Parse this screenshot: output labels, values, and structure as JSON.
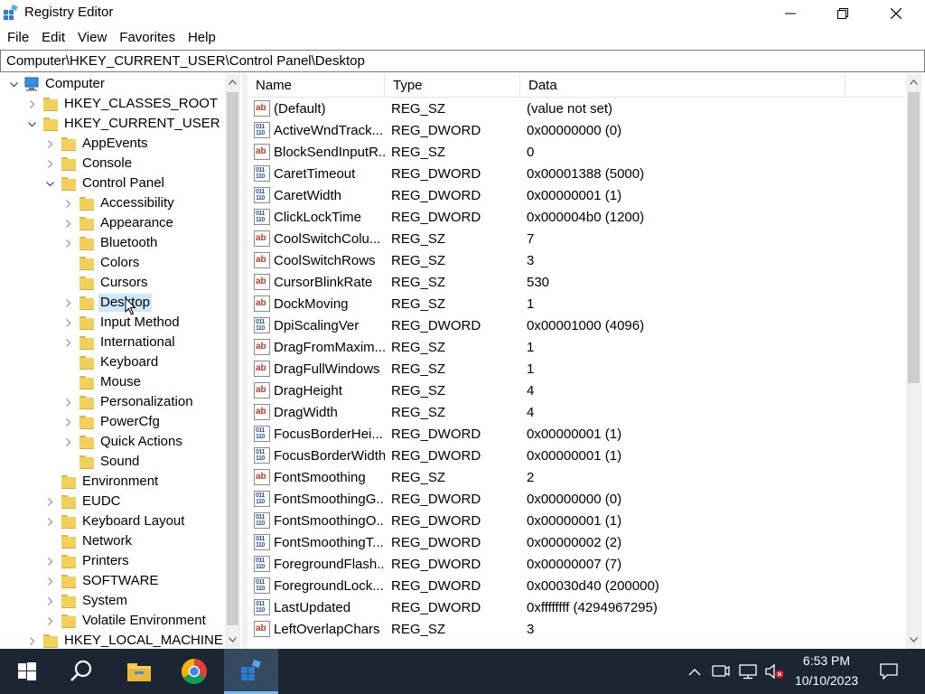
{
  "window": {
    "title": "Registry Editor",
    "app_icon": "registry-editor-icon",
    "controls": [
      "minimize-icon",
      "restore-icon",
      "close-icon"
    ]
  },
  "menu": [
    "File",
    "Edit",
    "View",
    "Favorites",
    "Help"
  ],
  "address": "Computer\\HKEY_CURRENT_USER\\Control Panel\\Desktop",
  "tree": [
    {
      "label": "Computer",
      "level": 0,
      "expanded": true,
      "icon": "computer-icon"
    },
    {
      "label": "HKEY_CLASSES_ROOT",
      "level": 1,
      "expanded": false
    },
    {
      "label": "HKEY_CURRENT_USER",
      "level": 1,
      "expanded": true
    },
    {
      "label": "AppEvents",
      "level": 2,
      "expanded": false
    },
    {
      "label": "Console",
      "level": 2,
      "expanded": false
    },
    {
      "label": "Control Panel",
      "level": 2,
      "expanded": true
    },
    {
      "label": "Accessibility",
      "level": 3,
      "expanded": false
    },
    {
      "label": "Appearance",
      "level": 3,
      "expanded": false
    },
    {
      "label": "Bluetooth",
      "level": 3,
      "expanded": false
    },
    {
      "label": "Colors",
      "level": 3,
      "leaf": true
    },
    {
      "label": "Cursors",
      "level": 3,
      "leaf": true
    },
    {
      "label": "Desktop",
      "level": 3,
      "expanded": false,
      "selected": true
    },
    {
      "label": "Input Method",
      "level": 3,
      "expanded": false
    },
    {
      "label": "International",
      "level": 3,
      "expanded": false
    },
    {
      "label": "Keyboard",
      "level": 3,
      "leaf": true
    },
    {
      "label": "Mouse",
      "level": 3,
      "leaf": true
    },
    {
      "label": "Personalization",
      "level": 3,
      "expanded": false
    },
    {
      "label": "PowerCfg",
      "level": 3,
      "expanded": false
    },
    {
      "label": "Quick Actions",
      "level": 3,
      "expanded": false
    },
    {
      "label": "Sound",
      "level": 3,
      "leaf": true
    },
    {
      "label": "Environment",
      "level": 2,
      "leaf": true
    },
    {
      "label": "EUDC",
      "level": 2,
      "expanded": false
    },
    {
      "label": "Keyboard Layout",
      "level": 2,
      "expanded": false
    },
    {
      "label": "Network",
      "level": 2,
      "leaf": true
    },
    {
      "label": "Printers",
      "level": 2,
      "expanded": false
    },
    {
      "label": "SOFTWARE",
      "level": 2,
      "expanded": false
    },
    {
      "label": "System",
      "level": 2,
      "expanded": false
    },
    {
      "label": "Volatile Environment",
      "level": 2,
      "expanded": false
    },
    {
      "label": "HKEY_LOCAL_MACHINE",
      "level": 1,
      "expanded": false
    }
  ],
  "columns": [
    "Name",
    "Type",
    "Data"
  ],
  "values": [
    {
      "name": "(Default)",
      "type": "REG_SZ",
      "data": "(value not set)",
      "icon": "string-value-icon"
    },
    {
      "name": "ActiveWndTrack...",
      "type": "REG_DWORD",
      "data": "0x00000000 (0)",
      "icon": "binary-value-icon"
    },
    {
      "name": "BlockSendInputR...",
      "type": "REG_SZ",
      "data": "0",
      "icon": "string-value-icon"
    },
    {
      "name": "CaretTimeout",
      "type": "REG_DWORD",
      "data": "0x00001388 (5000)",
      "icon": "binary-value-icon"
    },
    {
      "name": "CaretWidth",
      "type": "REG_DWORD",
      "data": "0x00000001 (1)",
      "icon": "binary-value-icon"
    },
    {
      "name": "ClickLockTime",
      "type": "REG_DWORD",
      "data": "0x000004b0 (1200)",
      "icon": "binary-value-icon"
    },
    {
      "name": "CoolSwitchColu...",
      "type": "REG_SZ",
      "data": "7",
      "icon": "string-value-icon"
    },
    {
      "name": "CoolSwitchRows",
      "type": "REG_SZ",
      "data": "3",
      "icon": "string-value-icon"
    },
    {
      "name": "CursorBlinkRate",
      "type": "REG_SZ",
      "data": "530",
      "icon": "string-value-icon"
    },
    {
      "name": "DockMoving",
      "type": "REG_SZ",
      "data": "1",
      "icon": "string-value-icon"
    },
    {
      "name": "DpiScalingVer",
      "type": "REG_DWORD",
      "data": "0x00001000 (4096)",
      "icon": "binary-value-icon"
    },
    {
      "name": "DragFromMaxim...",
      "type": "REG_SZ",
      "data": "1",
      "icon": "string-value-icon"
    },
    {
      "name": "DragFullWindows",
      "type": "REG_SZ",
      "data": "1",
      "icon": "string-value-icon"
    },
    {
      "name": "DragHeight",
      "type": "REG_SZ",
      "data": "4",
      "icon": "string-value-icon"
    },
    {
      "name": "DragWidth",
      "type": "REG_SZ",
      "data": "4",
      "icon": "string-value-icon"
    },
    {
      "name": "FocusBorderHei...",
      "type": "REG_DWORD",
      "data": "0x00000001 (1)",
      "icon": "binary-value-icon"
    },
    {
      "name": "FocusBorderWidth",
      "type": "REG_DWORD",
      "data": "0x00000001 (1)",
      "icon": "binary-value-icon"
    },
    {
      "name": "FontSmoothing",
      "type": "REG_SZ",
      "data": "2",
      "icon": "string-value-icon"
    },
    {
      "name": "FontSmoothingG...",
      "type": "REG_DWORD",
      "data": "0x00000000 (0)",
      "icon": "binary-value-icon"
    },
    {
      "name": "FontSmoothingO...",
      "type": "REG_DWORD",
      "data": "0x00000001 (1)",
      "icon": "binary-value-icon"
    },
    {
      "name": "FontSmoothingT...",
      "type": "REG_DWORD",
      "data": "0x00000002 (2)",
      "icon": "binary-value-icon"
    },
    {
      "name": "ForegroundFlash...",
      "type": "REG_DWORD",
      "data": "0x00000007 (7)",
      "icon": "binary-value-icon"
    },
    {
      "name": "ForegroundLock...",
      "type": "REG_DWORD",
      "data": "0x00030d40 (200000)",
      "icon": "binary-value-icon"
    },
    {
      "name": "LastUpdated",
      "type": "REG_DWORD",
      "data": "0xffffffff (4294967295)",
      "icon": "binary-value-icon"
    },
    {
      "name": "LeftOverlapChars",
      "type": "REG_SZ",
      "data": "3",
      "icon": "string-value-icon"
    }
  ],
  "taskbar": {
    "items": [
      "start-icon",
      "search-icon",
      "file-explorer-icon",
      "chrome-icon",
      "registry-editor-icon"
    ],
    "tray_icons": [
      "chevron-up-icon",
      "meet-now-icon",
      "network-icon",
      "volume-muted-icon"
    ],
    "time": "6:53 PM",
    "date": "10/10/2023",
    "notification_icon": "notification-icon"
  },
  "colors": {
    "selection": "#cce8ff",
    "taskbar": "#1c2633",
    "folder": "#f3cf5c"
  }
}
